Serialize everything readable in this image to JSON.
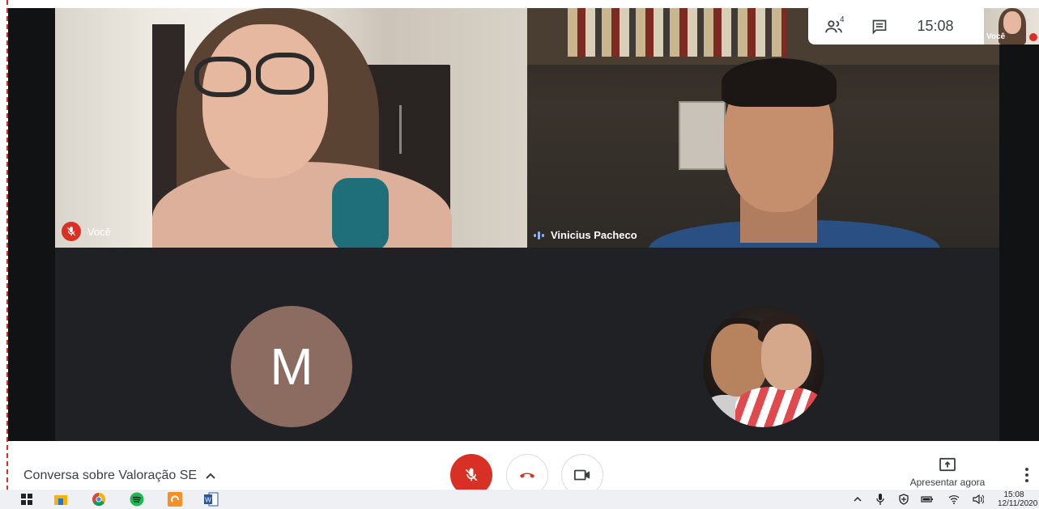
{
  "meeting": {
    "title": "Conversa sobre Valoração SE",
    "clock": "15:08",
    "participant_count": "4"
  },
  "tiles": {
    "self_label": "Você",
    "remote_name": "Vinicius Pacheco",
    "avatar_letter": "M"
  },
  "self_view": {
    "label": "Você"
  },
  "controls": {
    "present_label": "Apresentar agora"
  },
  "taskbar": {
    "time": "15:08",
    "date": "12/11/2020"
  },
  "colors": {
    "meet_red": "#d93025",
    "stage_bg": "#202124",
    "avatar_m_bg": "#8c6b60",
    "speaking_blue": "#8ab4f8"
  },
  "icons": {
    "people": "people-icon",
    "chat": "chat-icon",
    "mic_off": "mic-off-icon",
    "end_call": "phone-hangup-icon",
    "camera": "video-camera-icon",
    "present": "present-screen-icon",
    "more": "more-vert-icon"
  }
}
